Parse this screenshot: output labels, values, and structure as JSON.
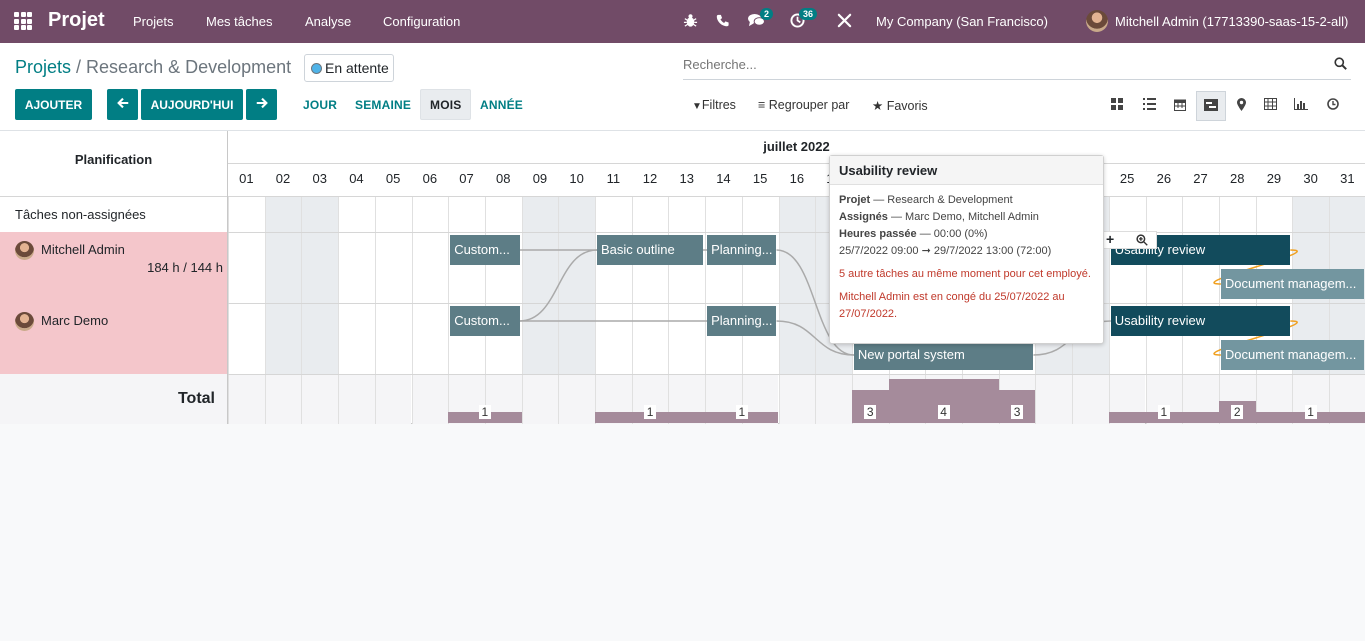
{
  "navbar": {
    "app_name": "Projet",
    "menus": [
      "Projets",
      "Mes tâches",
      "Analyse",
      "Configuration"
    ],
    "messages_badge": "2",
    "activities_badge": "36",
    "company": "My Company (San Francisco)",
    "user": "Mitchell Admin (17713390-saas-15-2-all)"
  },
  "control_panel": {
    "breadcrumb_root": "Projets",
    "breadcrumb_separator": " / ",
    "breadcrumb_current": "Research & Development",
    "status": "En attente",
    "search_placeholder": "Recherche...",
    "add_button": "AJOUTER",
    "today_button": "AUJOURD'HUI",
    "ranges": [
      "JOUR",
      "SEMAINE",
      "MOIS",
      "ANNÉE"
    ],
    "active_range": "MOIS",
    "filters": "Filtres",
    "group_by": "Regrouper par",
    "favorites": "Favoris",
    "views": [
      "kanban-icon",
      "list-icon",
      "calendar-icon",
      "gantt-icon",
      "map-icon",
      "pivot-icon",
      "graph-icon",
      "activity-icon"
    ],
    "active_view": "gantt-icon"
  },
  "gantt": {
    "header_label": "Planification",
    "month": "juillet 2022",
    "days": [
      "01",
      "02",
      "03",
      "04",
      "05",
      "06",
      "07",
      "08",
      "09",
      "10",
      "11",
      "12",
      "13",
      "14",
      "15",
      "16",
      "17",
      "18",
      "19",
      "20",
      "21",
      "22",
      "23",
      "24",
      "25",
      "26",
      "27",
      "28",
      "29",
      "30",
      "31"
    ],
    "weekend_days": [
      "02",
      "03",
      "09",
      "10",
      "16",
      "17",
      "23",
      "24",
      "30",
      "31"
    ],
    "rows": [
      {
        "label": "Tâches non-assignées"
      },
      {
        "label": "Mitchell Admin",
        "hours": "184 h / 144 h",
        "avatar": true
      },
      {
        "label": "Marc Demo",
        "avatar": true
      }
    ],
    "total_label": "Total",
    "tasks": [
      {
        "row": 1,
        "name": "Custom...",
        "start": 7,
        "end": 8,
        "style": "grey"
      },
      {
        "row": 1,
        "name": "Basic outline",
        "start": 11,
        "end": 13,
        "style": "grey"
      },
      {
        "row": 1,
        "name": "Planning...",
        "start": 14,
        "end": 15,
        "style": "grey"
      },
      {
        "row": 1,
        "name": "Usability review",
        "start": 25,
        "end": 29,
        "style": "dark"
      },
      {
        "row": 1,
        "name": "Document managem...",
        "start": 28,
        "end": 31,
        "style": "light",
        "sub": true
      },
      {
        "row": 2,
        "name": "Custom...",
        "start": 7,
        "end": 8,
        "style": "grey"
      },
      {
        "row": 2,
        "name": "Planning...",
        "start": 14,
        "end": 15,
        "style": "grey"
      },
      {
        "row": 2,
        "name": "New portal system",
        "start": 18,
        "end": 22,
        "style": "grey",
        "sub": true
      },
      {
        "row": 2,
        "name": "Usability review",
        "start": 25,
        "end": 29,
        "style": "dark"
      },
      {
        "row": 2,
        "name": "Document managem...",
        "start": 28,
        "end": 31,
        "style": "light",
        "sub": true
      }
    ],
    "totals": [
      {
        "start": 7,
        "end": 8,
        "value": "1",
        "level": 1
      },
      {
        "start": 11,
        "end": 13,
        "value": "1",
        "level": 1
      },
      {
        "start": 14,
        "end": 15,
        "value": "1",
        "level": 1
      },
      {
        "start": 18,
        "end": 18,
        "value": "3",
        "level": 3
      },
      {
        "start": 19,
        "end": 21,
        "value": "4",
        "level": 4
      },
      {
        "start": 22,
        "end": 22,
        "value": "3",
        "level": 3
      },
      {
        "start": 25,
        "end": 27,
        "value": "1",
        "level": 1
      },
      {
        "start": 28,
        "end": 28,
        "value": "2",
        "level": 2
      },
      {
        "start": 29,
        "end": 31,
        "value": "1",
        "level": 1
      }
    ]
  },
  "popover": {
    "title": "Usability review",
    "project_label": "Projet",
    "project_value": " — Research & Development",
    "assignees_label": "Assignés",
    "assignees_value": " — Marc Demo, Mitchell Admin",
    "hours_label": "Heures passée",
    "hours_value": " — 00:00 (0%)",
    "dates": "25/7/2022 09:00 ➞ 29/7/2022 13:00 (72:00)",
    "warning_overlap": "5 autre tâches au même moment pour cet employé.",
    "warning_leave": "Mitchell Admin est en congé du 25/07/2022 au 27/07/2022."
  }
}
